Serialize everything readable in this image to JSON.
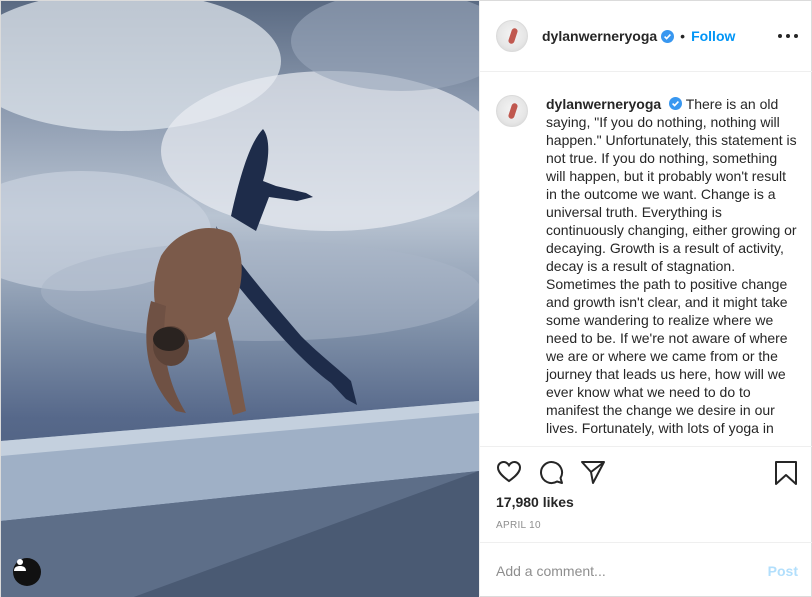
{
  "post": {
    "username": "dylanwerneryoga",
    "follow_label": "Follow",
    "separator": "•",
    "caption": "There is an old saying, \"If you do nothing, nothing will happen.\" Unfortunately, this statement is not true. If you do nothing, something will happen, but it probably won't result in the outcome we want. Change is a universal truth. Everything is continuously changing, either growing or decaying. Growth is a result of activity, decay is a result of stagnation. Sometimes the path to positive change and growth isn't clear, and it might take some wandering to realize where we need to be. If we're not aware of where we are or where we came from or the journey that leads us here, how will we ever know what we need to do to manifest the change we desire in our lives. Fortunately, with lots of yoga in",
    "likes": "17,980 likes",
    "date": "APRIL 10",
    "comment_placeholder": "Add a comment...",
    "post_label": "Post",
    "verified_color": "#3897f0",
    "link_color": "#0095f6"
  },
  "icons": {
    "like": "heart-icon",
    "comment": "comment-icon",
    "share": "share-icon",
    "save": "bookmark-icon",
    "more": "more-options-icon",
    "tag": "user-tag-icon"
  }
}
